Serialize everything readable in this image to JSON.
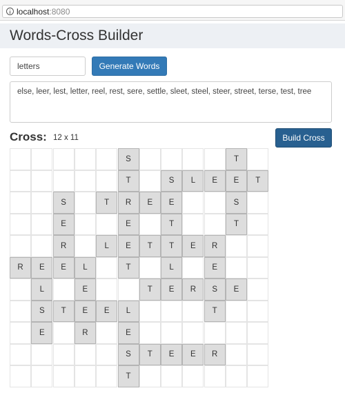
{
  "browser": {
    "host": "localhost",
    "port": ":8080"
  },
  "app": {
    "title": "Words-Cross Builder"
  },
  "controls": {
    "letters_value": "letters",
    "generate_label": "Generate Words",
    "build_label": "Build Cross"
  },
  "words": "else, leer, lest, letter, reel, rest, sere, settle, sleet, steel, steer, street, terse, test, tree",
  "cross": {
    "label": "Cross:",
    "size": "12 x 11",
    "grid": [
      "     S    T ",
      "     T SLEET",
      "  S TREE  S ",
      "  E  E T  T ",
      "  R LETTER  ",
      "REEL T L E  ",
      " L E  TERSE ",
      " STEEL   T  ",
      " E R E      ",
      "     STEER  ",
      "     T      "
    ]
  }
}
